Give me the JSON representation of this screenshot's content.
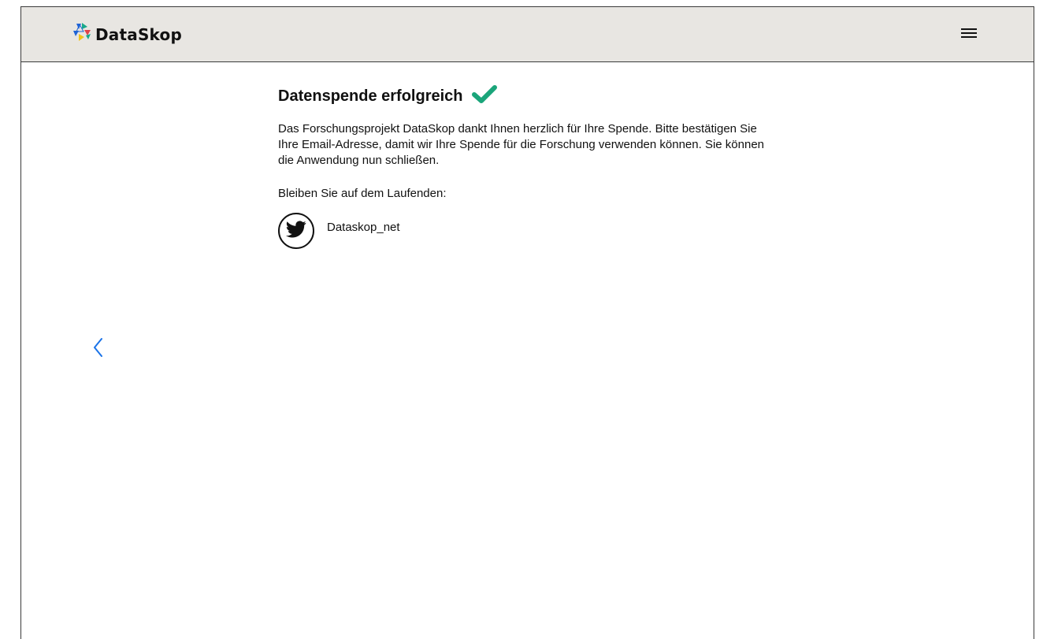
{
  "header": {
    "brand_name": "DataSkop",
    "logo_icon": "dataskop-logo-icon",
    "menu_icon": "hamburger-menu-icon"
  },
  "navigation": {
    "back_icon": "chevron-left-icon",
    "back_color": "#1a73e8"
  },
  "main": {
    "title": "Datenspende erfolgreich",
    "title_icon": "checkmark-icon",
    "check_color": "#1aa57a",
    "message": "Das Forschungsprojekt DataSkop dankt Ihnen herzlich für Ihre Spende. Bitte bestätigen Sie Ihre Email-Adresse, damit wir Ihre Spende für die Forschung verwenden können. Sie können die Anwendung nun schließen.",
    "stay_updated_label": "Bleiben Sie auf dem Laufenden:",
    "social": {
      "icon": "twitter-icon",
      "handle": "Dataskop_net"
    }
  },
  "colors": {
    "header_bg": "#e8e6e2",
    "logo_blue": "#1f63d6",
    "logo_teal": "#18a88a",
    "logo_yellow": "#f2c31a",
    "logo_red": "#e2434b"
  }
}
